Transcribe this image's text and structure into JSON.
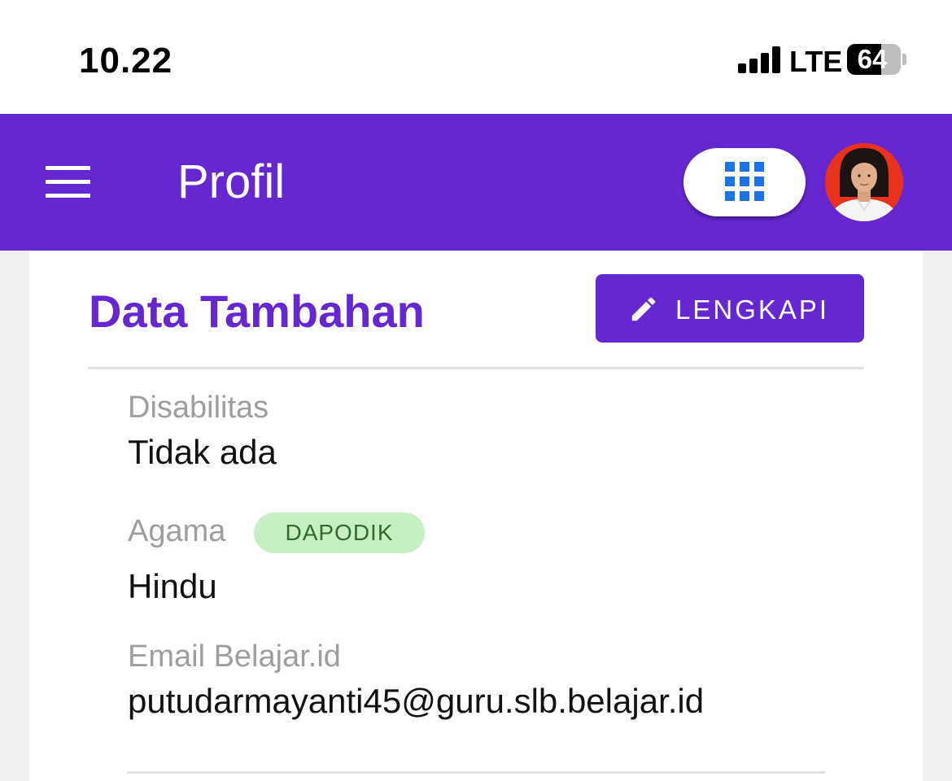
{
  "status_bar": {
    "time": "10.22",
    "network": "LTE",
    "battery_percent": 64,
    "battery_label": "64",
    "signal_icon": "signal-bars-icon"
  },
  "app_bar": {
    "title": "Profil",
    "menu_icon": "hamburger-menu-icon",
    "apps_icon": "apps-grid-icon",
    "background_color": "#6427d0"
  },
  "section": {
    "title": "Data Tambahan",
    "edit_button_label": "LENGKAPI",
    "edit_icon": "pencil-icon"
  },
  "fields": [
    {
      "label": "Disabilitas",
      "value": "Tidak ada"
    },
    {
      "label": "Agama",
      "badge": "DAPODIK",
      "value": "Hindu"
    },
    {
      "label": "Email Belajar.id",
      "value": "putudarmayanti45@guru.slb.belajar.id"
    }
  ],
  "colors": {
    "accent": "#6427d0",
    "badge_bg": "#c6efc4",
    "badge_text": "#2f6b2f",
    "apps_icon": "#1a73e8"
  }
}
